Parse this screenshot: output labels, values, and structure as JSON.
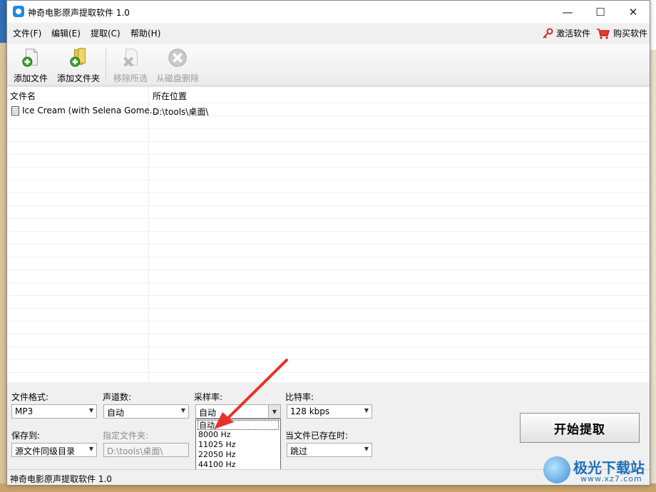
{
  "window": {
    "title": "神奇电影原声提取软件 1.0"
  },
  "titlebar_buttons": {
    "minimize": "—",
    "maximize": "☐",
    "close": "✕"
  },
  "menu": {
    "items": [
      "文件(F)",
      "编辑(E)",
      "提取(C)",
      "帮助(H)"
    ],
    "activate": "激活软件",
    "buy": "购买软件"
  },
  "toolbar": {
    "add_file": "添加文件",
    "add_folder": "添加文件夹",
    "remove_selected": "移除所选",
    "delete_from_disk": "从磁盘删除"
  },
  "list": {
    "columns": [
      "文件名",
      "所在位置"
    ],
    "rows": [
      {
        "name": "Ice Cream (with Selena Gome...",
        "location": "D:\\tools\\桌面\\"
      }
    ]
  },
  "settings": {
    "format_label": "文件格式:",
    "format_value": "MP3",
    "channels_label": "声道数:",
    "channels_value": "自动",
    "samplerate_label": "采样率:",
    "samplerate_value": "自动",
    "samplerate_options": [
      "自动",
      "8000 Hz",
      "11025 Hz",
      "22050 Hz",
      "44100 Hz"
    ],
    "bitrate_label": "比特率:",
    "bitrate_value": "128 kbps",
    "saveto_label": "保存到:",
    "saveto_value": "源文件同级目录",
    "folder_label": "指定文件夹:",
    "folder_value": "D:\\tools\\桌面\\",
    "exists_label": "当文件已存在时:",
    "exists_value": "跳过",
    "start_button": "开始提取"
  },
  "status": {
    "text": "神奇电影原声提取软件 1.0"
  },
  "watermark": {
    "name": "极光下载站",
    "url": "www.xz7.com"
  },
  "colors": {
    "accent": "#1e8be0",
    "annotation_arrow": "#e8322a",
    "watermark": "#1f6fb8"
  }
}
